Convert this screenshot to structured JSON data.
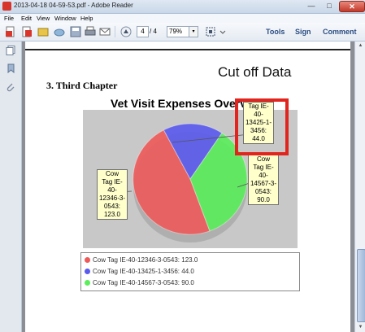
{
  "window": {
    "title": "2013-04-18 04-59-53.pdf - Adobe Reader",
    "min_glyph": "—",
    "max_glyph": "□",
    "close_glyph": "✕"
  },
  "menu": [
    "File",
    "Edit",
    "View",
    "Window",
    "Help"
  ],
  "toolbar": {
    "page_value": "4",
    "page_total": "/ 4",
    "zoom_value": "79%",
    "dropdown_glyph": "▾",
    "tools_label": "Tools",
    "sign_label": "Sign",
    "comment_label": "Comment"
  },
  "scroll": {
    "up_glyph": "▲",
    "down_glyph": "▼"
  },
  "document": {
    "annotation": "Cut off Data",
    "heading": "3. Third Chapter"
  },
  "chart_data": {
    "type": "pie",
    "title": "Vet Visit Expenses Overview",
    "slices": [
      {
        "label": "Cow Tag IE-40-12346-3-0543",
        "value": 123.0,
        "color": "#ee5a5a",
        "callout": "Cow\nTag IE-\n40-\n12346-3-\n0543:\n123.0"
      },
      {
        "label": "Cow Tag IE-40-13425-1-3456",
        "value": 44.0,
        "color": "#5a5aee",
        "callout": "Tag IE-\n40-\n13425-1-\n3456:\n44.0"
      },
      {
        "label": "Cow Tag IE-40-14567-3-0543",
        "value": 90.0,
        "color": "#5aee5a",
        "callout": "Cow\nTag IE-\n40-\n14567-3-\n0543:\n90.0"
      }
    ],
    "legend": [
      "Cow Tag IE-40-12346-3-0543: 123.0",
      "Cow Tag IE-40-13425-1-3456: 44.0",
      "Cow Tag IE-40-14567-3-0543: 90.0"
    ],
    "legend_position": "bottom"
  },
  "colors": {
    "highlight_box": "#e1241d",
    "link": "#2b4c80"
  }
}
